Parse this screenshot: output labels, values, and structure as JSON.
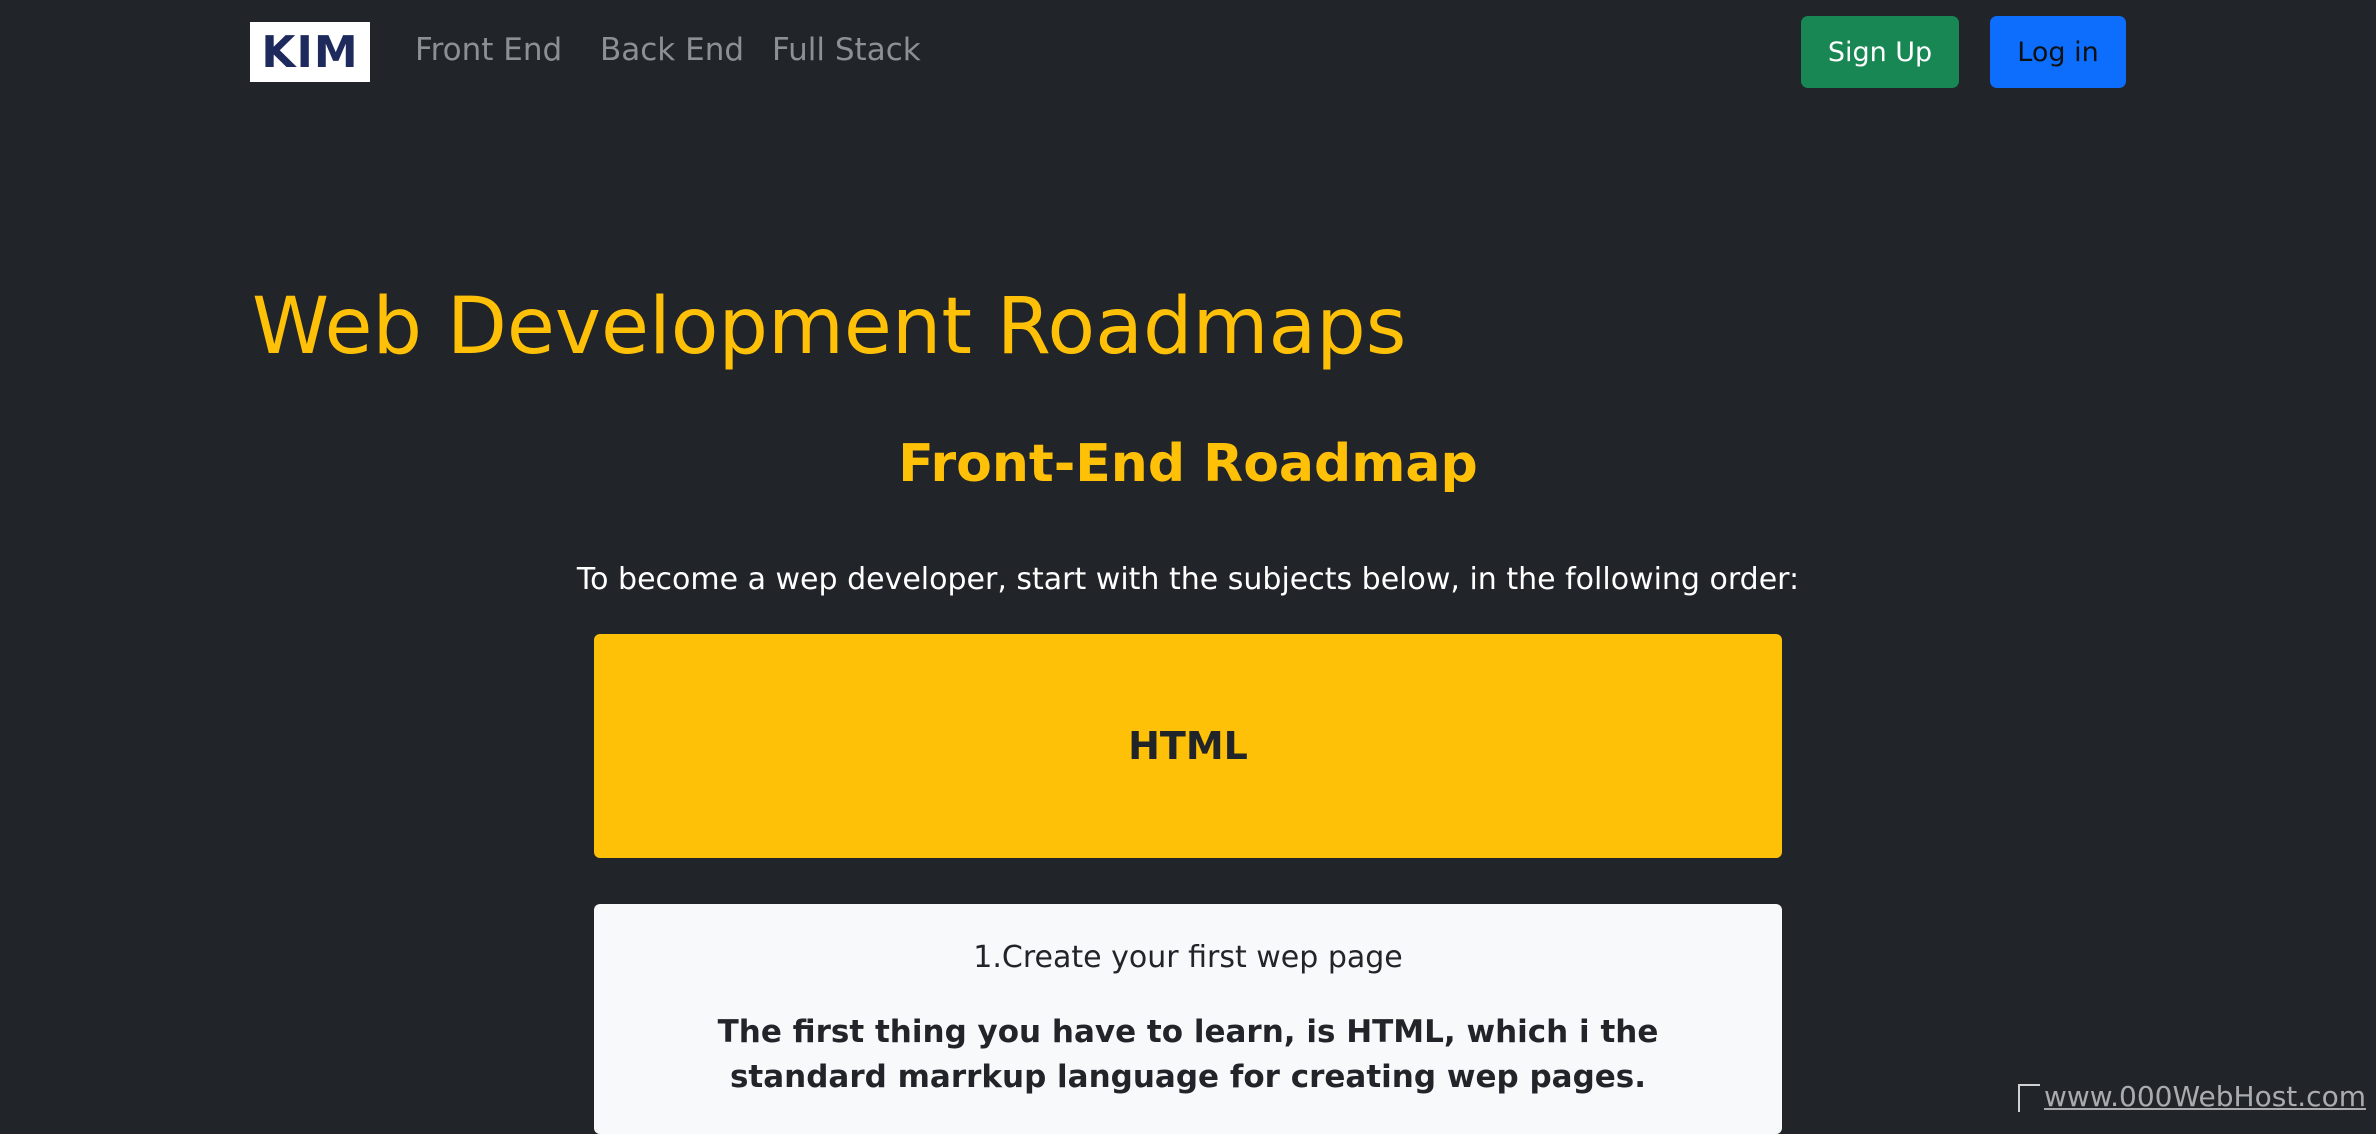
{
  "navbar": {
    "logo": "KIM",
    "links": [
      "Front End",
      "Back End",
      "Full Stack"
    ],
    "signup_label": "Sign Up",
    "login_label": "Log in"
  },
  "main": {
    "title": "Web Development Roadmaps",
    "section_title": "Front-End Roadmap",
    "intro": "To become a wep developer, start with the subjects below, in the following order:",
    "card_header": "HTML",
    "card_subtitle": "1.Create your first wep page",
    "card_text": "The first thing you have to learn, is HTML, which i the standard marrkup language for creating wep pages."
  },
  "footer": {
    "host_link": "www.000WebHost.com"
  },
  "colors": {
    "background": "#212529",
    "accent": "#ffc107",
    "signup": "#198754",
    "login": "#0d6efd",
    "card": "#f8f9fa"
  }
}
